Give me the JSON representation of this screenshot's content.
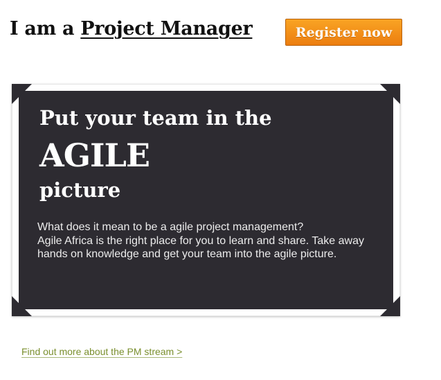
{
  "header": {
    "prefix": "I am a ",
    "role": "Project Manager",
    "register_label": "Register now"
  },
  "panel": {
    "headline_line1": "Put your team in the",
    "headline_line2": "AGILE",
    "headline_line3": "picture",
    "body_line1": "What does it mean to be a agile project management?",
    "body_line2": "Agile Africa is the right place for you to learn and share. Take away hands on knowledge and get your team into the agile picture."
  },
  "footer": {
    "link_label": "Find out more about the PM stream >"
  },
  "colors": {
    "panel_bg": "#2d2b31",
    "button_orange": "#f39220",
    "link_green": "#7a8f2e"
  }
}
